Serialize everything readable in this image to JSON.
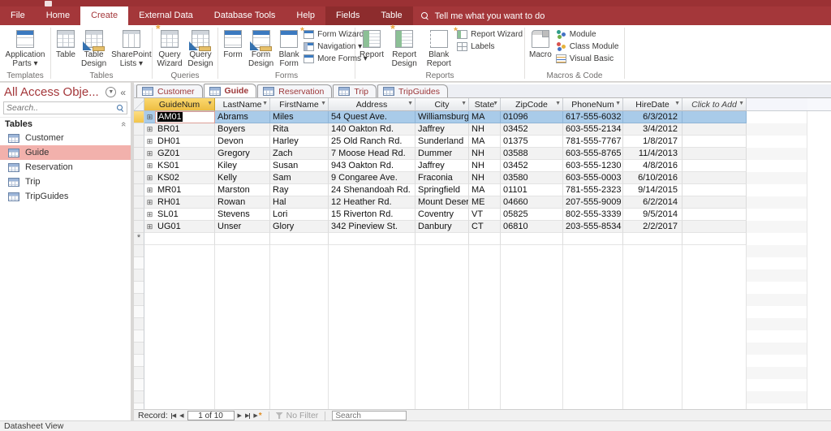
{
  "app": {
    "accent_red": "#a4373a",
    "contextual_tab_bg": "#8d2c2d",
    "selected_row_blue": "#a9cbe9",
    "selected_header_amber": "#f3c54a",
    "nav_selected_pink": "#f2b1ac"
  },
  "ribbon_tabs": {
    "items": [
      {
        "label": "File",
        "active": false,
        "contextual": false
      },
      {
        "label": "Home",
        "active": false,
        "contextual": false
      },
      {
        "label": "Create",
        "active": true,
        "contextual": false
      },
      {
        "label": "External Data",
        "active": false,
        "contextual": false
      },
      {
        "label": "Database Tools",
        "active": false,
        "contextual": false
      },
      {
        "label": "Help",
        "active": false,
        "contextual": false
      },
      {
        "label": "Fields",
        "active": false,
        "contextual": true
      },
      {
        "label": "Table",
        "active": false,
        "contextual": true
      }
    ],
    "tell_me": "Tell me what you want to do"
  },
  "ribbon": {
    "templates": {
      "label": "Templates",
      "app_parts": "Application Parts ▾"
    },
    "tables": {
      "label": "Tables",
      "table": "Table",
      "table_design": "Table Design",
      "sharepoint": "SharePoint Lists ▾"
    },
    "queries": {
      "label": "Queries",
      "wizard": "Query Wizard",
      "design": "Query Design"
    },
    "forms": {
      "label": "Forms",
      "form": "Form",
      "form_design": "Form Design",
      "blank_form": "Blank Form",
      "form_wizard": "Form Wizard",
      "navigation": "Navigation ▾",
      "more_forms": "More Forms ▾"
    },
    "reports": {
      "label": "Reports",
      "report": "Report",
      "report_design": "Report Design",
      "blank_report": "Blank Report",
      "report_wizard": "Report Wizard",
      "labels": "Labels"
    },
    "macros": {
      "label": "Macros & Code",
      "macro": "Macro",
      "module": "Module",
      "class_module": "Class Module",
      "visual_basic": "Visual Basic"
    }
  },
  "nav_pane": {
    "title": "All Access Obje...",
    "search_placeholder": "Search..",
    "section": "Tables",
    "items": [
      {
        "label": "Customer",
        "selected": false
      },
      {
        "label": "Guide",
        "selected": true
      },
      {
        "label": "Reservation",
        "selected": false
      },
      {
        "label": "Trip",
        "selected": false
      },
      {
        "label": "TripGuides",
        "selected": false
      }
    ]
  },
  "doc_tabs": {
    "items": [
      {
        "label": "Customer",
        "active": false
      },
      {
        "label": "Guide",
        "active": true
      },
      {
        "label": "Reservation",
        "active": false
      },
      {
        "label": "Trip",
        "active": false
      },
      {
        "label": "TripGuides",
        "active": false
      }
    ]
  },
  "datasheet": {
    "columns": [
      "GuideNum",
      "LastName",
      "FirstName",
      "Address",
      "City",
      "State",
      "ZipCode",
      "PhoneNum",
      "HireDate",
      "Click to Add"
    ],
    "selected_column": "GuideNum",
    "selected_cell": {
      "row_index": 0,
      "column": "GuideNum",
      "value": "AM01"
    },
    "new_record_symbol": "*",
    "rows": [
      [
        "AM01",
        "Abrams",
        "Miles",
        "54 Quest Ave.",
        "Williamsburg",
        "MA",
        "01096",
        "617-555-6032",
        "6/3/2012"
      ],
      [
        "BR01",
        "Boyers",
        "Rita",
        "140 Oakton Rd.",
        "Jaffrey",
        "NH",
        "03452",
        "603-555-2134",
        "3/4/2012"
      ],
      [
        "DH01",
        "Devon",
        "Harley",
        "25 Old Ranch Rd.",
        "Sunderland",
        "MA",
        "01375",
        "781-555-7767",
        "1/8/2017"
      ],
      [
        "GZ01",
        "Gregory",
        "Zach",
        "7 Moose Head Rd.",
        "Dummer",
        "NH",
        "03588",
        "603-555-8765",
        "11/4/2013"
      ],
      [
        "KS01",
        "Kiley",
        "Susan",
        "943 Oakton Rd.",
        "Jaffrey",
        "NH",
        "03452",
        "603-555-1230",
        "4/8/2016"
      ],
      [
        "KS02",
        "Kelly",
        "Sam",
        "9 Congaree Ave.",
        "Fraconia",
        "NH",
        "03580",
        "603-555-0003",
        "6/10/2016"
      ],
      [
        "MR01",
        "Marston",
        "Ray",
        "24 Shenandoah Rd.",
        "Springfield",
        "MA",
        "01101",
        "781-555-2323",
        "9/14/2015"
      ],
      [
        "RH01",
        "Rowan",
        "Hal",
        "12 Heather Rd.",
        "Mount Desert",
        "ME",
        "04660",
        "207-555-9009",
        "6/2/2014"
      ],
      [
        "SL01",
        "Stevens",
        "Lori",
        "15 Riverton Rd.",
        "Coventry",
        "VT",
        "05825",
        "802-555-3339",
        "9/5/2014"
      ],
      [
        "UG01",
        "Unser",
        "Glory",
        "342 Pineview St.",
        "Danbury",
        "CT",
        "06810",
        "203-555-8534",
        "2/2/2017"
      ]
    ]
  },
  "record_nav": {
    "label": "Record:",
    "position": "1 of 10",
    "filter": "No Filter",
    "search_placeholder": "Search"
  },
  "status_bar": {
    "view_label": "Datasheet View"
  }
}
